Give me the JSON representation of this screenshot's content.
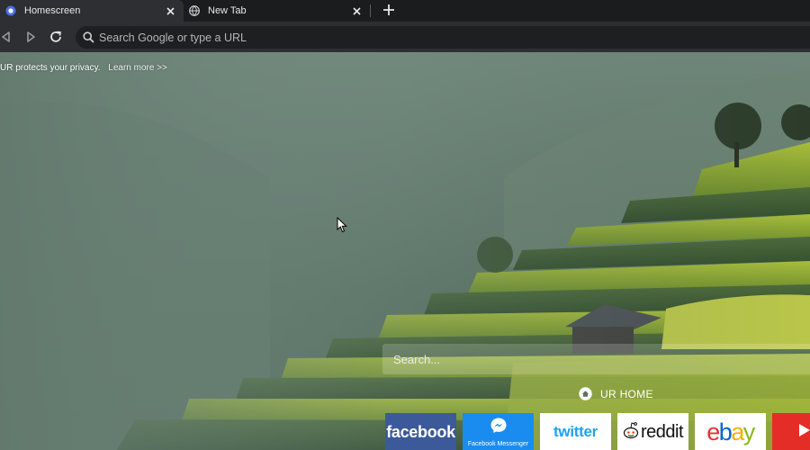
{
  "tabs": [
    {
      "label": "Homescreen",
      "favicon": "ur-browser-icon",
      "active": true
    },
    {
      "label": "New Tab",
      "favicon": "globe-icon",
      "active": false
    }
  ],
  "toolbar": {
    "omnibox_placeholder": "Search Google or type a URL"
  },
  "banner": {
    "privacy_text": "UR protects your privacy.",
    "learn_more": "Learn more >>"
  },
  "page": {
    "search_placeholder": "Search...",
    "home_label": "UR HOME"
  },
  "shortcuts": [
    {
      "id": "facebook",
      "label": "facebook",
      "color": "#3c5a99"
    },
    {
      "id": "messenger",
      "label": "Facebook Messenger",
      "color": "#1a8cf0"
    },
    {
      "id": "twitter",
      "label": "twitter",
      "color": "#1da1f2"
    },
    {
      "id": "reddit",
      "label": "reddit",
      "color": "#ff4500"
    },
    {
      "id": "ebay",
      "label": "ebay",
      "color": "#e53238"
    },
    {
      "id": "youtube",
      "label": "",
      "color": "#e52d27"
    }
  ],
  "colors": {
    "tabstrip_bg": "#1b1c1e",
    "toolbar_bg": "#2e2f33",
    "omnibox_bg": "#1e1f21"
  }
}
